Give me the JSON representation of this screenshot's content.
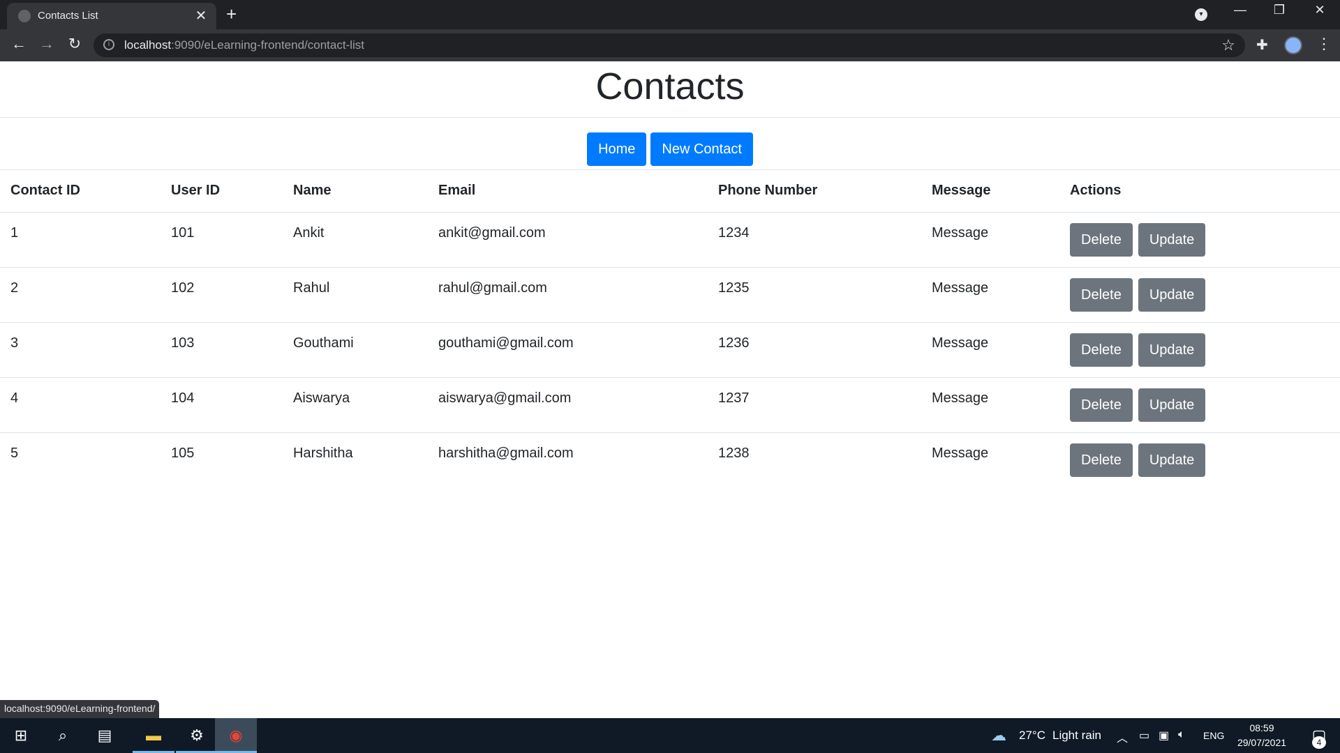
{
  "browser": {
    "tab_title": "Contacts List",
    "tab_close": "✕",
    "new_tab": "+",
    "url_host": "localhost",
    "url_rest": ":9090/eLearning-frontend/contact-list",
    "status_url": "localhost:9090/eLearning-frontend/"
  },
  "page": {
    "title": "Contacts",
    "home_button": "Home",
    "new_contact_button": "New Contact"
  },
  "table": {
    "headers": [
      "Contact ID",
      "User ID",
      "Name",
      "Email",
      "Phone Number",
      "Message",
      "Actions"
    ],
    "rows": [
      {
        "contact_id": "1",
        "user_id": "101",
        "name": "Ankit",
        "email": "ankit@gmail.com",
        "phone": "1234",
        "message": "Message"
      },
      {
        "contact_id": "2",
        "user_id": "102",
        "name": "Rahul",
        "email": "rahul@gmail.com",
        "phone": "1235",
        "message": "Message"
      },
      {
        "contact_id": "3",
        "user_id": "103",
        "name": "Gouthami",
        "email": "gouthami@gmail.com",
        "phone": "1236",
        "message": "Message"
      },
      {
        "contact_id": "4",
        "user_id": "104",
        "name": "Aiswarya",
        "email": "aiswarya@gmail.com",
        "phone": "1237",
        "message": "Message"
      },
      {
        "contact_id": "5",
        "user_id": "105",
        "name": "Harshitha",
        "email": "harshitha@gmail.com",
        "phone": "1238",
        "message": "Message"
      }
    ],
    "delete_label": "Delete",
    "update_label": "Update"
  },
  "taskbar": {
    "weather": "27°C",
    "weather_desc": "Light rain",
    "language": "ENG",
    "time": "08:59",
    "date": "29/07/2021",
    "notification_count": "4"
  },
  "colors": {
    "primary": "#007bff",
    "secondary": "#6c757d",
    "chrome_dark": "#202124",
    "taskbar": "#0f1a26"
  }
}
